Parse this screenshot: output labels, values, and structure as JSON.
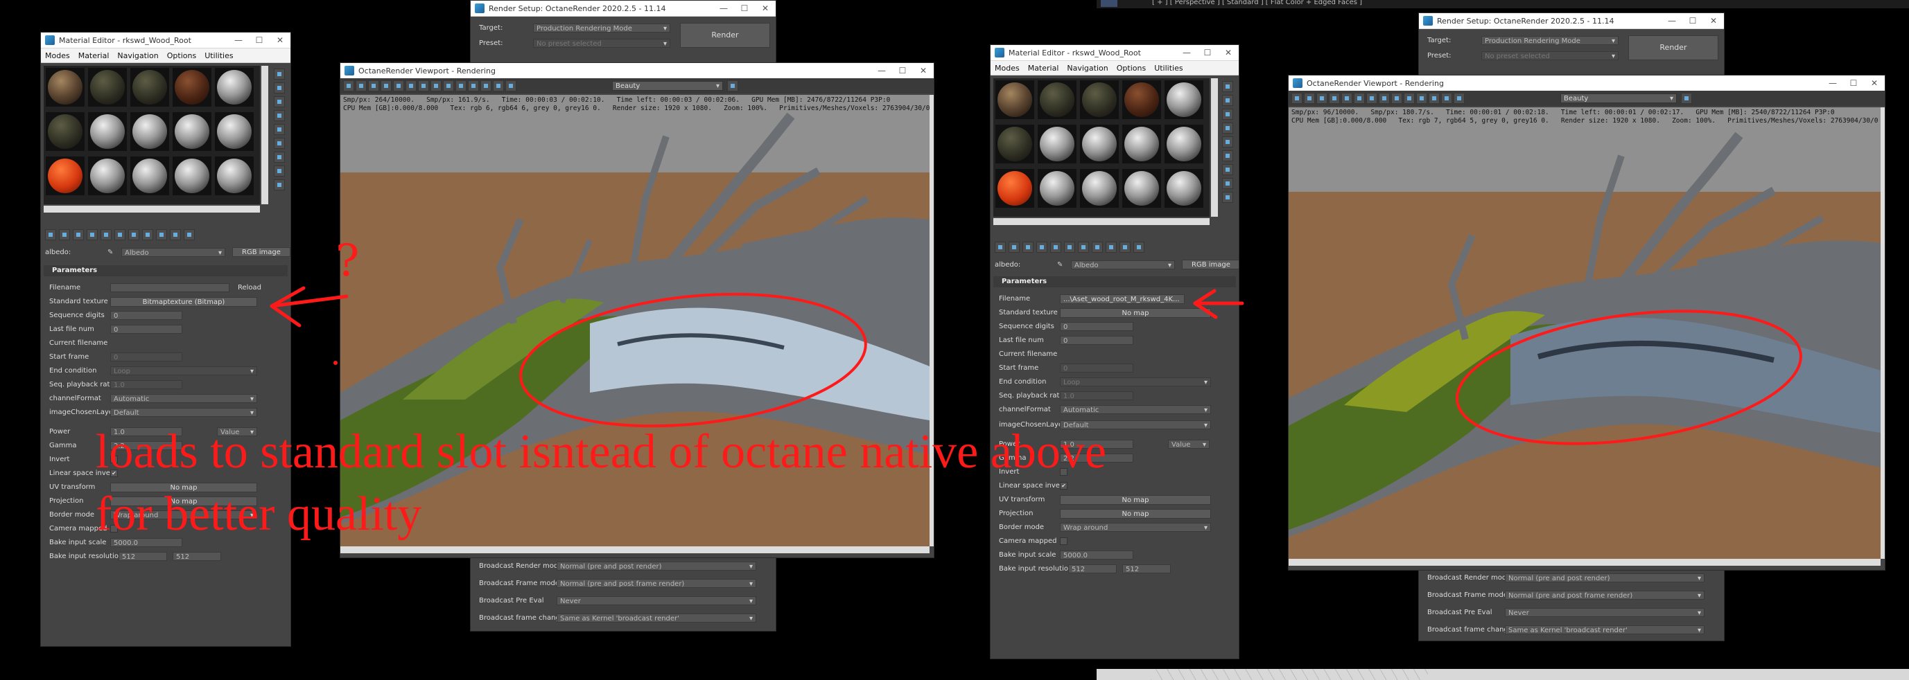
{
  "max_top_bar": {
    "text": "[ + ] [ Perspective ] [ Standard ] [ Flat Color + Edged Faces ]"
  },
  "render_setup": {
    "title": "Render Setup: OctaneRender 2020.2.5 - 11.14",
    "target_label": "Target:",
    "target_value": "Production Rendering Mode",
    "preset_label": "Preset:",
    "preset_value": "No preset selected",
    "render_button": "Render",
    "rows": [
      {
        "label": "Broadcast Render mode",
        "value": "Normal (pre and post render)"
      },
      {
        "label": "Broadcast Frame mode",
        "value": "Normal (pre and post frame render)"
      },
      {
        "label": "Broadcast Pre Eval",
        "value": "Never"
      },
      {
        "label": "Broadcast frame change",
        "value": "Same as Kernel 'broadcast render'"
      }
    ]
  },
  "material_editor": {
    "title": "Material Editor - rkswd_Wood_Root",
    "menu": [
      "Modes",
      "Material",
      "Navigation",
      "Options",
      "Utilities"
    ],
    "albedo_label": "albedo:",
    "albedo_value": "Albedo",
    "map_type": "RGB image",
    "parameters_header": "Parameters",
    "left": {
      "filename_label": "Filename",
      "filename_value": "",
      "reload_label": "Reload",
      "standard_texture_label": "Standard texture",
      "standard_texture_value": "Bitmaptexture (Bitmap)",
      "sequence_digits": "0",
      "last_file_num": "0",
      "start_frame": "0",
      "end_condition": "Loop",
      "seq_playback_rate": "1.0",
      "channel_format": "Automatic",
      "image_chosen_layer": "Default",
      "power": "1.0",
      "power_mode": "Value",
      "gamma": "2.2",
      "uv_transform": "No map",
      "projection": "No map",
      "border_mode": "Wrap around",
      "bake_input_scale": "5000.0",
      "bake_res_x": "512",
      "bake_res_y": "512"
    },
    "right": {
      "filename_value": "...\\Aset_wood_root_M_rkswd_4K...",
      "standard_texture_value": "No map",
      "sequence_digits": "0",
      "last_file_num": "0",
      "start_frame": "0",
      "end_condition": "Loop",
      "seq_playback_rate": "1.0",
      "channel_format": "Automatic",
      "image_chosen_layer": "Default",
      "power": "1.0",
      "power_mode": "Value",
      "gamma": "2.2",
      "uv_transform": "No map",
      "projection": "No map",
      "border_mode": "Wrap around",
      "bake_input_scale": "5000.0",
      "bake_res_x": "512",
      "bake_res_y": "512"
    },
    "labels": {
      "filename": "Filename",
      "standard_texture": "Standard texture",
      "sequence_digits": "Sequence digits",
      "last_file_num": "Last file num",
      "current_filename": "Current filename",
      "start_frame": "Start frame",
      "end_condition": "End condition",
      "seq_playback_rate": "Seq. playback rate",
      "channel_format": "channelFormat",
      "image_chosen_layer": "imageChosenLaye...",
      "power": "Power",
      "gamma": "Gamma",
      "invert": "Invert",
      "linear_space_invert": "Linear space invert",
      "uv_transform": "UV transform",
      "projection": "Projection",
      "border_mode": "Border mode",
      "camera_mapped": "Camera mapped",
      "bake_input_scale": "Bake input scale",
      "bake_input_resolution": "Bake input resolution"
    }
  },
  "viewport": {
    "title": "OctaneRender Viewport - Rendering",
    "pass": "Beauty",
    "left_stats_line1": "Smp/px: 264/10000.   Smp/px: 161.9/s.   Time: 00:00:03 / 00:02:10.   Time left: 00:00:03 / 00:02:06.   GPU Mem [MB]: 2476/8722/11264 P3P:0",
    "left_stats_line2": "CPU Mem [GB]:0.000/8.000   Tex: rgb 6, rgb64 6, grey 0, grey16 0.   Render size: 1920 x 1080.   Zoom: 100%.   Primitives/Meshes/Voxels: 2763904/30/0",
    "right_stats_line1": "Smp/px: 96/10000.   Smp/px: 180.7/s.   Time: 00:00:01 / 00:02:18.   Time left: 00:00:01 / 00:02:17.   GPU Mem [MB]: 2540/8722/11264 P3P:0",
    "right_stats_line2": "CPU Mem [GB]:0.000/8.000   Tex: rgb 7, rgb64 5, grey 0, grey16 0.   Render size: 1920 x 1080.   Zoom: 100%.   Primitives/Meshes/Voxels: 2763904/30/0"
  },
  "annotation": {
    "line1": "loads to standard slot isntead of octane native above",
    "line2": "for better quality",
    "question": "?",
    "color": "#ff1a1a"
  },
  "window_controls": {
    "minimize": "—",
    "maximize": "☐",
    "close": "✕"
  },
  "bottom_edge": {
    "color": "#d8d8d8"
  }
}
